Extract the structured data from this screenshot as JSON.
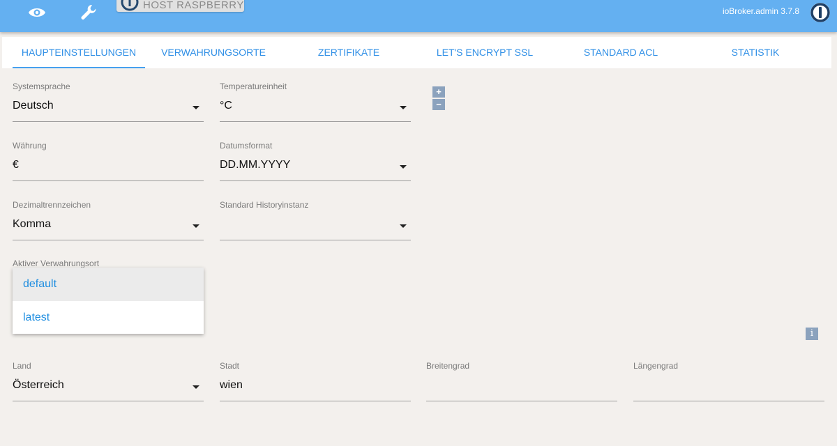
{
  "header": {
    "host_button_label": "HOST RASPBERRYPI",
    "version": "ioBroker.admin 3.7.8",
    "bg_color": "#64b0f1"
  },
  "tabs": [
    {
      "label": "HAUPTEINSTELLUNGEN",
      "active": true
    },
    {
      "label": "VERWAHRUNGSORTE",
      "active": false
    },
    {
      "label": "ZERTIFIKATE",
      "active": false
    },
    {
      "label": "LET'S ENCRYPT SSL",
      "active": false
    },
    {
      "label": "STANDARD ACL",
      "active": false
    },
    {
      "label": "STATISTIK",
      "active": false
    }
  ],
  "fields": {
    "systemsprache": {
      "label": "Systemsprache",
      "value": "Deutsch"
    },
    "temperatureinheit": {
      "label": "Temperatureinheit",
      "value": "°C"
    },
    "waehrung": {
      "label": "Währung",
      "value": "€"
    },
    "datumsformat": {
      "label": "Datumsformat",
      "value": "DD.MM.YYYY"
    },
    "dezimaltrennzeichen": {
      "label": "Dezimaltrennzeichen",
      "value": "Komma"
    },
    "historyinstanz": {
      "label": "Standard Historyinstanz",
      "value": ""
    },
    "land": {
      "label": "Land",
      "value": "Österreich"
    },
    "stadt": {
      "label": "Stadt",
      "value": "wien"
    },
    "breitengrad": {
      "label": "Breitengrad",
      "value": ""
    },
    "laengengrad": {
      "label": "Längengrad",
      "value": ""
    }
  },
  "stepper": {
    "plus": "+",
    "minus": "−"
  },
  "verwahrungsort": {
    "label": "Aktiver Verwahrungsort",
    "options": [
      "default",
      "latest"
    ],
    "selected": "default"
  },
  "info_glyph": "i",
  "accent_color": "#2f8fe6"
}
